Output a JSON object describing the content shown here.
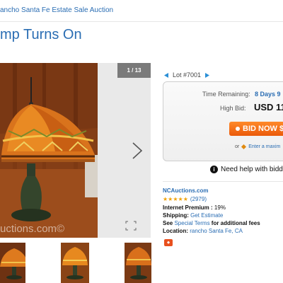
{
  "breadcrumb": {
    "text": "ancho Santa Fe Estate Sale Auction"
  },
  "page": {
    "title": "mp Turns On"
  },
  "gallery": {
    "counter": "1 / 13",
    "watermark": "uctions.com©"
  },
  "lot": {
    "label": "Lot #7001"
  },
  "bid_panel": {
    "time_remaining_label": "Time Remaining:",
    "time_remaining_value": "8 Days 9",
    "high_bid_label": "High Bid:",
    "high_bid_value": "USD 11.",
    "bid_button_label": "BID NOW $",
    "or_text": "or",
    "max_bid_link": "Enter a maxim"
  },
  "help": {
    "text": "Need help with biddi"
  },
  "seller": {
    "name": "NCAuctions.com",
    "stars": "★★★★★",
    "rating_count": "(2979)",
    "internet_premium_label": "Internet Premium :",
    "internet_premium_value": "19%",
    "shipping_label": "Shipping:",
    "shipping_link": "Get Estimate",
    "see_text": "See",
    "special_terms_link": "Special Terms",
    "additional_fees_text": "for additional fees",
    "location_label": "Location:",
    "location_value": "rancho Santa Fe, CA"
  },
  "colors": {
    "link": "#2a6db3",
    "bid_button": "#ea5a0a",
    "stars": "#f0a30a"
  }
}
